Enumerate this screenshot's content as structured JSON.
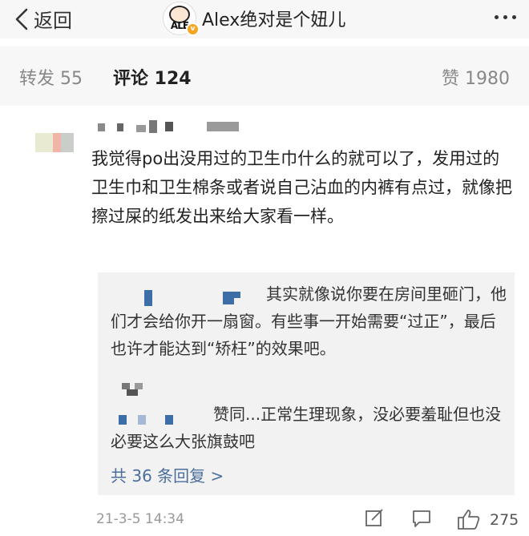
{
  "header": {
    "back_label": "返回",
    "title": "Alex绝对是个妞儿",
    "avatar_logo_text": "ALE",
    "verified_badge": "v"
  },
  "tabs": [
    {
      "label": "转发 55",
      "active": false
    },
    {
      "label": "评论 124",
      "active": true
    },
    {
      "label": "赞 1980",
      "active": false
    }
  ],
  "comment": {
    "text": "我觉得po出没用过的卫生巾什么的就可以了，发用过的卫生巾和卫生棉条或者说自己沾血的内裤有点过，就像把擦过屎的纸发出来给大家看一样。",
    "replies": [
      {
        "text": "其实就像说你要在房间里砸门，他们才会给你开一扇窗。有些事一开始需要“过正”，最后也许才能达到“矫枉”的效果吧。"
      },
      {
        "text": "赞同...正常生理现象，没必要羞耻但也没必要这么大张旗鼓吧"
      }
    ],
    "more_replies": "共 36 条回复 >",
    "timestamp": "21-3-5 14:34",
    "like_count": "275"
  },
  "colors": {
    "header_bg": "#f7f7f7",
    "reply_bg": "#f2f2f2",
    "link_blue": "#4a6e9e",
    "muted_text": "#999999"
  },
  "icons": [
    "back-chevron-icon",
    "more-dots-icon",
    "share-edit-icon",
    "comment-bubble-icon",
    "thumbs-up-icon"
  ]
}
